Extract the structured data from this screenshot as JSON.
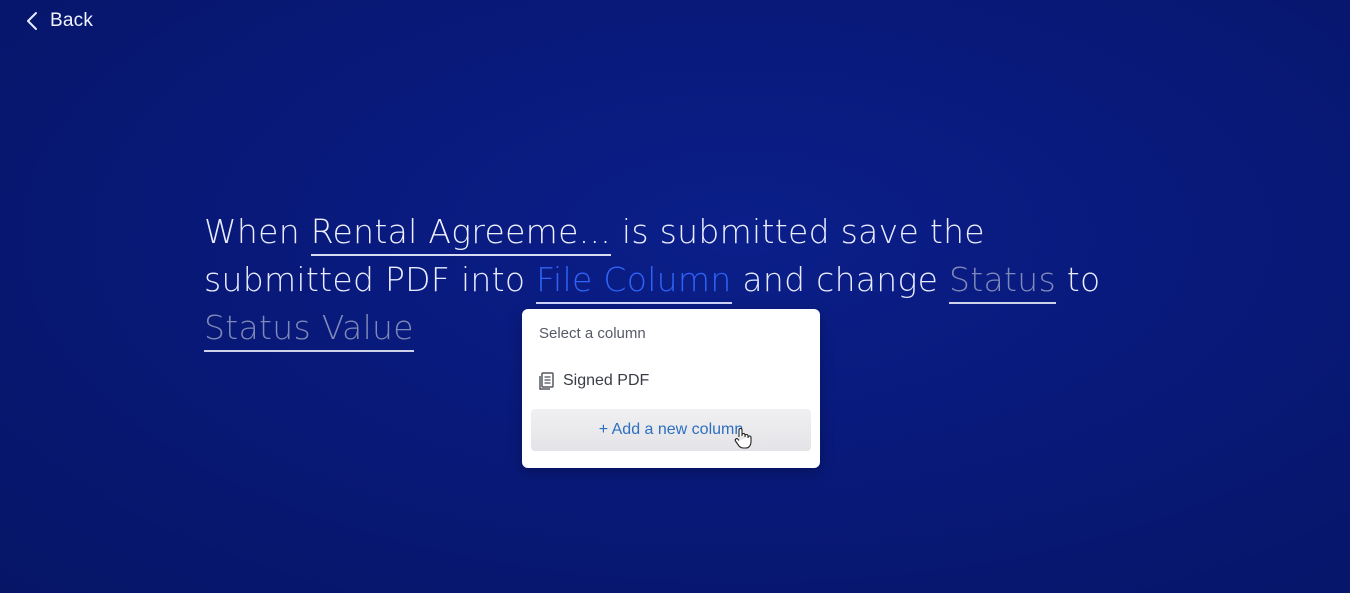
{
  "back": {
    "label": "Back"
  },
  "sentence": {
    "part1": "When ",
    "form_field": "Rental Agreeme...",
    "part2": " is submitted save the",
    "part3": "submitted PDF into ",
    "file_field": "File Column",
    "part4": " and change ",
    "status_field": "Status",
    "part5": " to",
    "status_value_field": "Status Value"
  },
  "dropdown": {
    "header": "Select a column",
    "items": [
      {
        "label": "Signed PDF",
        "icon": "document-icon"
      }
    ],
    "add_label": "+ Add a new column"
  },
  "colors": {
    "background": "#08197a",
    "active_field": "#2f63f5",
    "placeholder_field": "#7f89b8",
    "add_link": "#2d6fc0"
  }
}
